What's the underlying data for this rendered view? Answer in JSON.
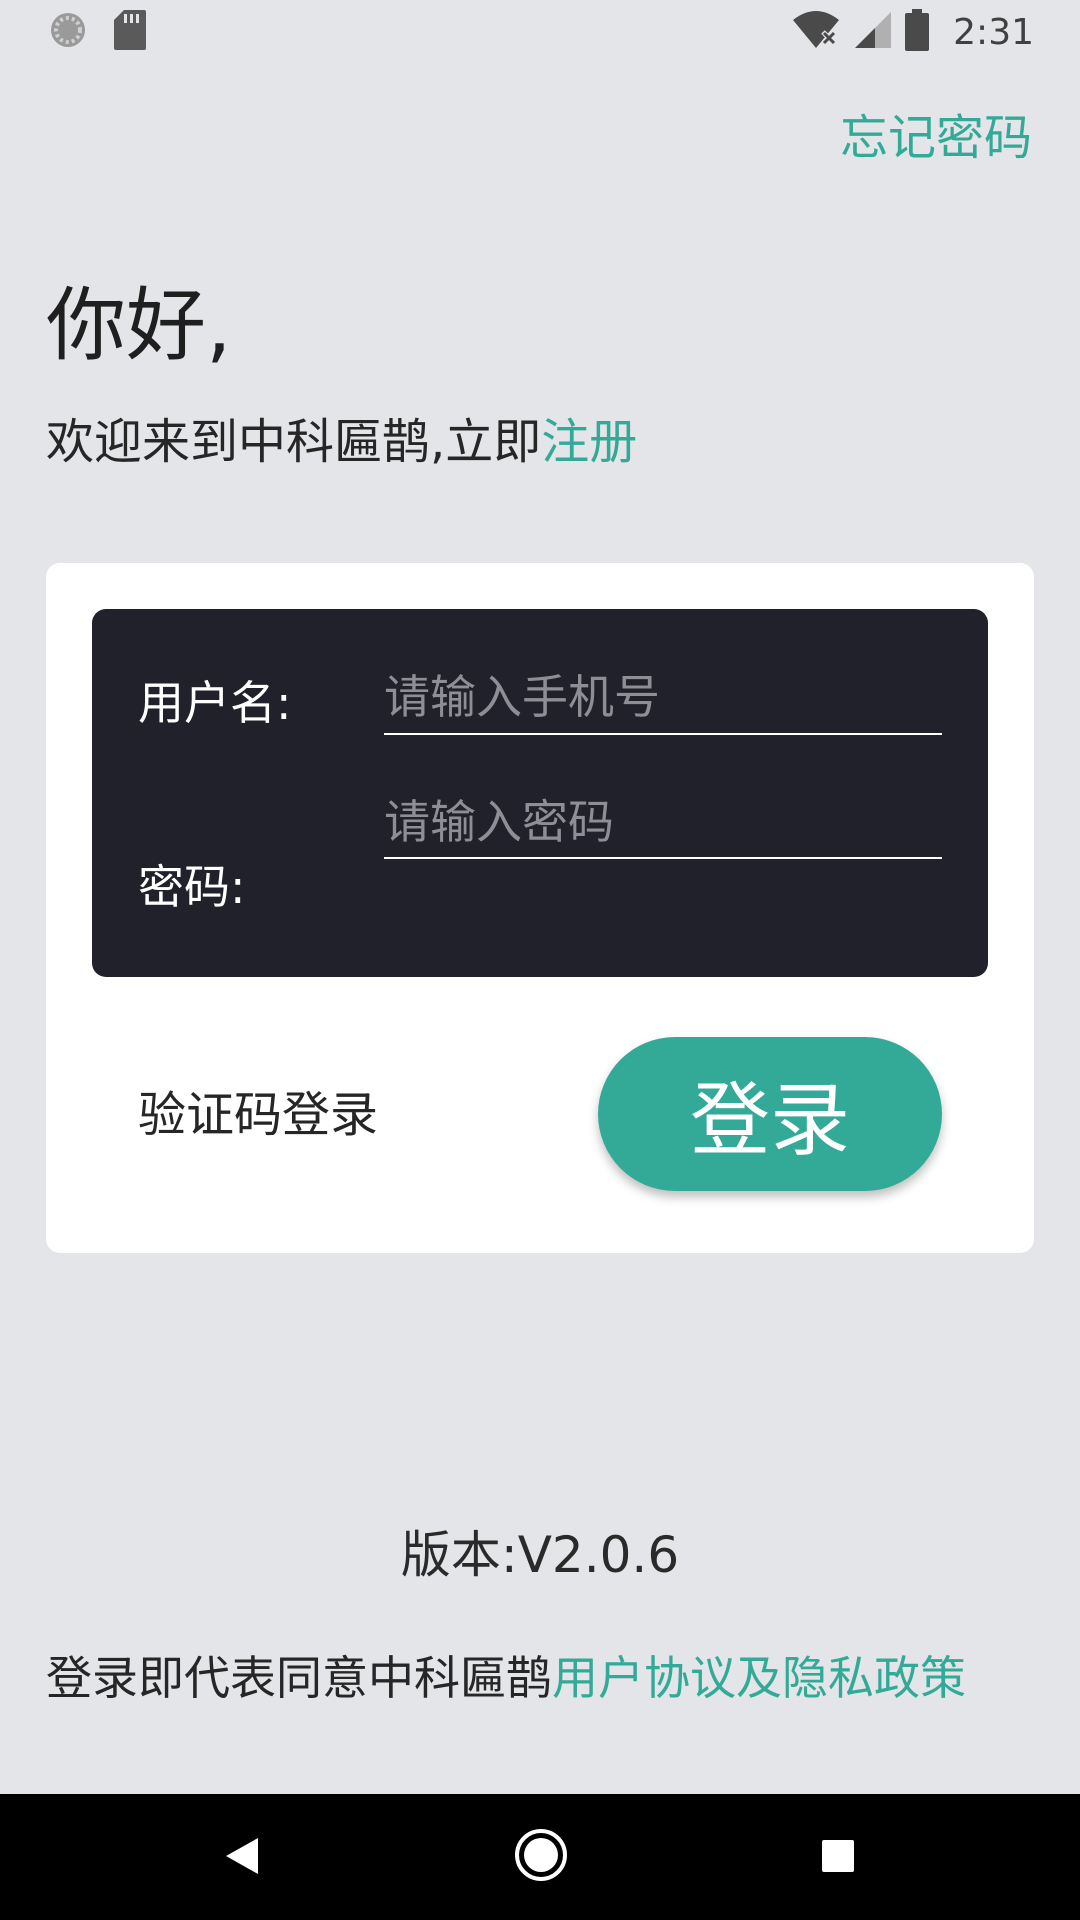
{
  "status_bar": {
    "time": "2:31",
    "icons": [
      "sync-icon",
      "sd-card-icon",
      "wifi-off-icon",
      "signal-icon",
      "battery-icon"
    ]
  },
  "header": {
    "forgot_password": "忘记密码"
  },
  "greeting": {
    "title": "你好,",
    "welcome_prefix": "欢迎来到中科匾鹊,立即",
    "register_link": "注册"
  },
  "form": {
    "username_label": "用户名:",
    "username_placeholder": "请输入手机号",
    "username_value": "",
    "password_label": "密码:",
    "password_placeholder": "请输入密码",
    "password_value": ""
  },
  "actions": {
    "sms_login": "验证码登录",
    "login_button": "登录"
  },
  "footer": {
    "version": "版本:V2.0.6",
    "agreement_prefix": "登录即代表同意中科匾鹊",
    "agreement_link": "用户协议及隐私政策"
  },
  "colors": {
    "accent": "#33aa98",
    "background": "#e4e5e8",
    "panel": "#20212a"
  }
}
